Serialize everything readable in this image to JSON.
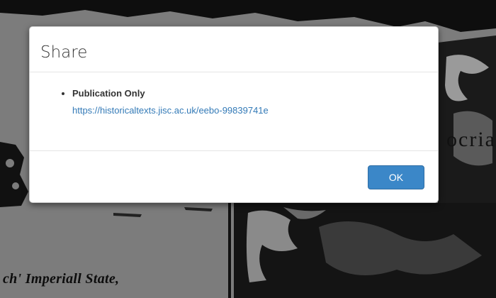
{
  "background": {
    "caption": "ch' Imperiall State,",
    "crest_text": "ocria"
  },
  "dialog": {
    "title": "Share",
    "items": [
      {
        "label": "Publication Only",
        "link": "https://historicaltexts.jisc.ac.uk/eebo-99839741e"
      }
    ],
    "ok_label": "OK"
  },
  "colors": {
    "backdrop": "#7c7c7c",
    "link": "#337ab7",
    "primary_button": "#3b87c8"
  }
}
